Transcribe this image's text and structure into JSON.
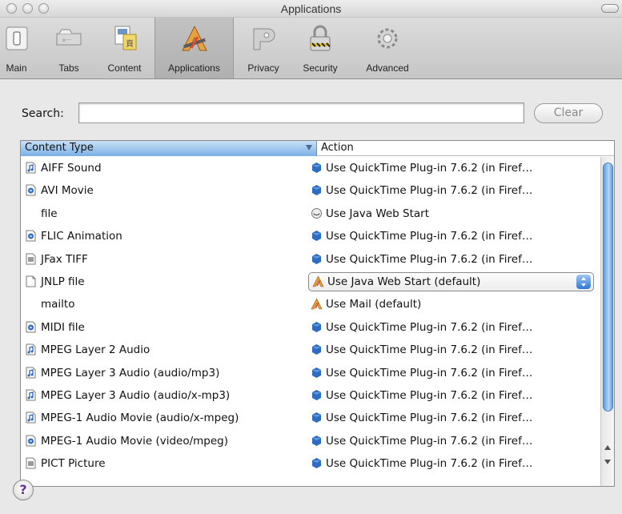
{
  "window": {
    "title": "Applications"
  },
  "toolbar": {
    "items": [
      {
        "label": "Main",
        "icon": "main-switch-icon"
      },
      {
        "label": "Tabs",
        "icon": "tabs-icon"
      },
      {
        "label": "Content",
        "icon": "content-icon"
      },
      {
        "label": "Applications",
        "icon": "applications-icon",
        "selected": true
      },
      {
        "label": "Privacy",
        "icon": "privacy-key-icon"
      },
      {
        "label": "Security",
        "icon": "security-lock-icon"
      },
      {
        "label": "Advanced",
        "icon": "advanced-gear-icon"
      }
    ]
  },
  "search": {
    "label": "Search:",
    "value": "",
    "clear_label": "Clear"
  },
  "table": {
    "col_type": "Content Type",
    "col_action": "Action",
    "rows": [
      {
        "type": "AIFF Sound",
        "action": "Use QuickTime Plug-in 7.6.2 (in Firef…",
        "file_icon": "audio-file-icon",
        "action_icon": "quicktime-icon"
      },
      {
        "type": "AVI Movie",
        "action": "Use QuickTime Plug-in 7.6.2 (in Firef…",
        "file_icon": "movie-file-icon",
        "action_icon": "quicktime-icon"
      },
      {
        "type": "file",
        "action": "Use Java Web Start",
        "file_icon": "",
        "action_icon": "java-icon"
      },
      {
        "type": "FLIC Animation",
        "action": "Use QuickTime Plug-in 7.6.2 (in Firef…",
        "file_icon": "movie-file-icon",
        "action_icon": "quicktime-icon"
      },
      {
        "type": "JFax TIFF",
        "action": "Use QuickTime Plug-in 7.6.2 (in Firef…",
        "file_icon": "image-file-icon",
        "action_icon": "quicktime-icon"
      },
      {
        "type": "JNLP file",
        "action": "Use Java Web Start (default)",
        "file_icon": "blank-file-icon",
        "action_icon": "application-icon",
        "popup": true
      },
      {
        "type": "mailto",
        "action": "Use Mail (default)",
        "file_icon": "",
        "action_icon": "application-icon"
      },
      {
        "type": "MIDI file",
        "action": "Use QuickTime Plug-in 7.6.2 (in Firef…",
        "file_icon": "movie-file-icon",
        "action_icon": "quicktime-icon"
      },
      {
        "type": "MPEG Layer 2 Audio",
        "action": "Use QuickTime Plug-in 7.6.2 (in Firef…",
        "file_icon": "audio-file-icon",
        "action_icon": "quicktime-icon"
      },
      {
        "type": "MPEG Layer 3 Audio (audio/mp3)",
        "action": "Use QuickTime Plug-in 7.6.2 (in Firef…",
        "file_icon": "audio-file-icon",
        "action_icon": "quicktime-icon"
      },
      {
        "type": "MPEG Layer 3 Audio (audio/x-mp3)",
        "action": "Use QuickTime Plug-in 7.6.2 (in Firef…",
        "file_icon": "audio-file-icon",
        "action_icon": "quicktime-icon"
      },
      {
        "type": "MPEG-1 Audio Movie (audio/x-mpeg)",
        "action": "Use QuickTime Plug-in 7.6.2 (in Firef…",
        "file_icon": "audio-file-icon",
        "action_icon": "quicktime-icon"
      },
      {
        "type": "MPEG-1 Audio Movie (video/mpeg)",
        "action": "Use QuickTime Plug-in 7.6.2 (in Firef…",
        "file_icon": "movie-file-icon",
        "action_icon": "quicktime-icon"
      },
      {
        "type": "PICT Picture",
        "action": "Use QuickTime Plug-in 7.6.2 (in Firef…",
        "file_icon": "image-file-icon",
        "action_icon": "quicktime-icon"
      }
    ]
  },
  "help": {
    "label": "?"
  },
  "colors": {
    "header_blue": "#7ab0e6",
    "scroll_blue": "#5f9be0",
    "quicktime_blue": "#2d6cc0",
    "help_purple": "#6b2fa0"
  }
}
